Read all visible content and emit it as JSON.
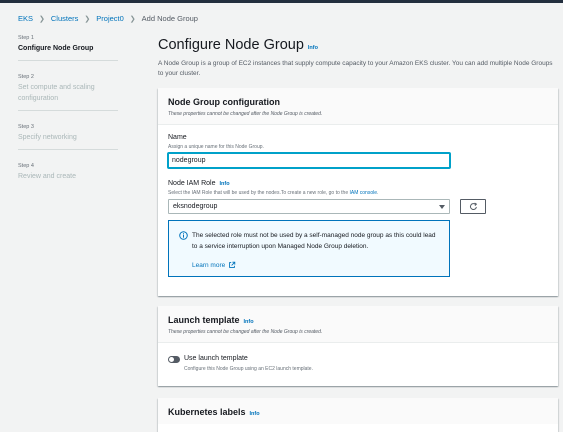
{
  "breadcrumb": {
    "items": [
      "EKS",
      "Clusters",
      "Project0",
      "Add Node Group"
    ]
  },
  "steps": [
    {
      "num": "Step 1",
      "name": "Configure Node Group"
    },
    {
      "num": "Step 2",
      "name": "Set compute and scaling configuration"
    },
    {
      "num": "Step 3",
      "name": "Specify networking"
    },
    {
      "num": "Step 4",
      "name": "Review and create"
    }
  ],
  "page": {
    "title": "Configure Node Group",
    "info": "Info",
    "description": "A Node Group is a group of EC2 instances that supply compute capacity to your Amazon EKS cluster. You can add multiple Node Groups to your cluster."
  },
  "config_panel": {
    "title": "Node Group configuration",
    "subtitle": "These properties cannot be changed after the Node Group is created.",
    "name_label": "Name",
    "name_desc": "Assign a unique name for this Node Group.",
    "name_value": "nodegroup",
    "role_label": "Node IAM Role",
    "role_info": "Info",
    "role_desc": "Select the IAM Role that will be used by the nodes.To create a new role, go to the ",
    "role_desc_link": "IAM console",
    "role_desc_end": ".",
    "role_value": "eksnodegroup",
    "alert_text": "The selected role must not be used by a self-managed node group as this could lead to a service interruption upon Managed Node Group deletion.",
    "learn_more": "Learn more"
  },
  "launch_panel": {
    "title": "Launch template",
    "info": "Info",
    "subtitle": "These properties cannot be changed after the Node Group is created.",
    "toggle_label": "Use launch template",
    "toggle_desc": "Configure this Node Group using an EC2 launch template."
  },
  "labels_panel": {
    "title": "Kubernetes labels",
    "info": "Info"
  },
  "colors": {
    "link": "#0073bb",
    "focus": "#00a1c9",
    "background": "#f2f3f3"
  }
}
